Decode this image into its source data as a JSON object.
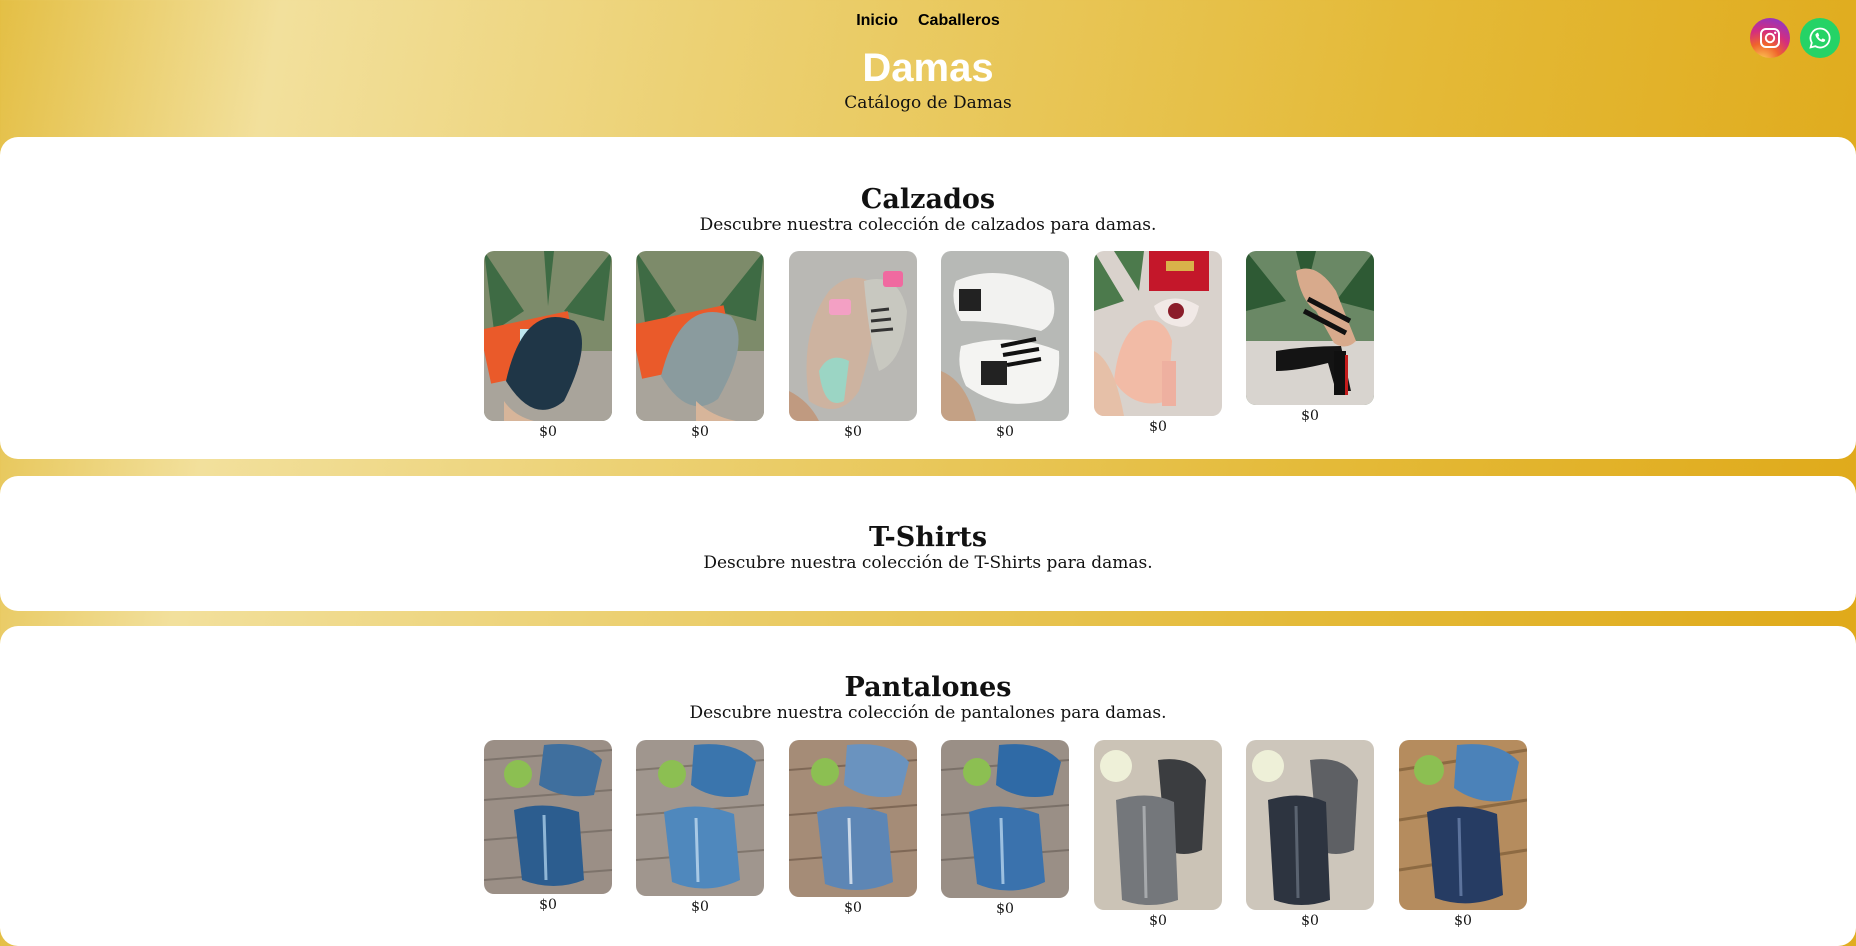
{
  "nav": {
    "items": [
      "Inicio",
      "Caballeros"
    ]
  },
  "social": {
    "icons": [
      "instagram-icon",
      "whatsapp-icon"
    ],
    "instagram_color": "#d42e7e",
    "whatsapp_color": "#25d366"
  },
  "hero": {
    "title": "Damas",
    "subtitle": "Catálogo de Damas"
  },
  "sections": [
    {
      "title": "Calzados",
      "description": "Descubre nuestra colección de calzados para damas.",
      "products": [
        {
          "price": "$0"
        },
        {
          "price": "$0"
        },
        {
          "price": "$0"
        },
        {
          "price": "$0"
        },
        {
          "price": "$0"
        },
        {
          "price": "$0"
        }
      ]
    },
    {
      "title": "T-Shirts",
      "description": "Descubre nuestra colección de T-Shirts para damas.",
      "products": []
    },
    {
      "title": "Pantalones",
      "description": "Descubre nuestra colección de pantalones para damas.",
      "products": [
        {
          "price": "$0"
        },
        {
          "price": "$0"
        },
        {
          "price": "$0"
        },
        {
          "price": "$0"
        },
        {
          "price": "$0"
        },
        {
          "price": "$0"
        },
        {
          "price": "$0"
        }
      ]
    }
  ],
  "colors": {
    "background_gold": "#e4ba38",
    "card_white": "#ffffff",
    "hero_title": "#ffffff"
  }
}
